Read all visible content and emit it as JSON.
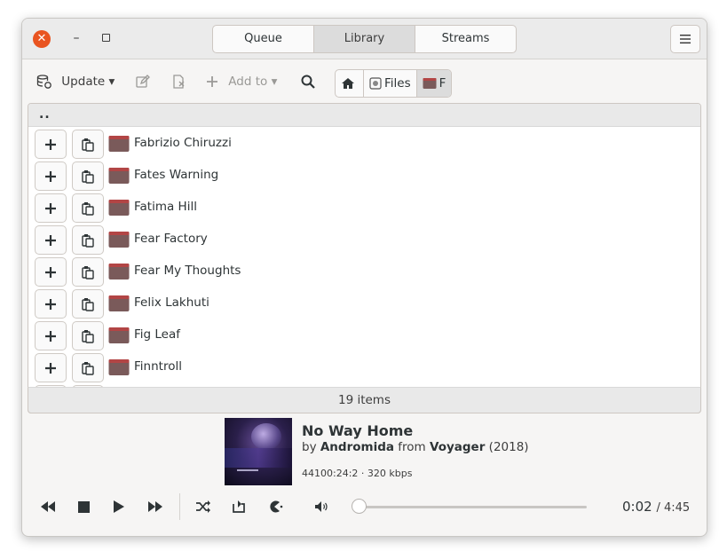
{
  "header": {
    "tabs": [
      {
        "label": "Queue"
      },
      {
        "label": "Library"
      },
      {
        "label": "Streams"
      }
    ],
    "menu_icon": "hamburger-menu-icon"
  },
  "toolbar": {
    "update_label": "Update ▾",
    "add_to_label": "Add to ▾",
    "path": [
      {
        "label": "",
        "icon": "home-icon"
      },
      {
        "label": "Files",
        "icon": "drive-icon"
      },
      {
        "label": "F",
        "icon": "folder-icon"
      }
    ]
  },
  "library": {
    "parent_label": "..",
    "folders": [
      {
        "name": "Fabrizio Chiruzzi"
      },
      {
        "name": "Fates Warning"
      },
      {
        "name": "Fatima Hill"
      },
      {
        "name": "Fear Factory"
      },
      {
        "name": "Fear My Thoughts"
      },
      {
        "name": "Felix Lakhuti"
      },
      {
        "name": "Fig Leaf"
      },
      {
        "name": "Finntroll"
      }
    ],
    "count_label": "19 items"
  },
  "now_playing": {
    "title": "No Way Home",
    "by": "by",
    "artist": "Andromida",
    "from": "from",
    "album": "Voyager",
    "year": "(2018)",
    "tech": "44100:24:2 · 320 kbps",
    "elapsed": "0:02",
    "total": "/ 4:45",
    "progress_fraction": 0.007
  },
  "colors": {
    "close_button": "#e95420",
    "folder": "#7a5a5a",
    "folder_tab": "#b24545"
  }
}
